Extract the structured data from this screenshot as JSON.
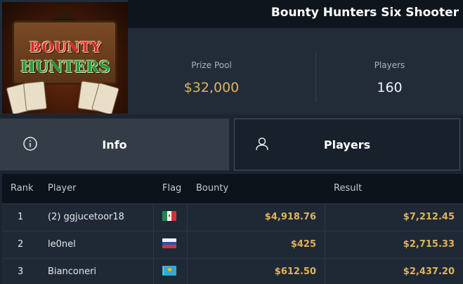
{
  "header": {
    "logo_text": [
      "BOUNTY",
      "HUNTERS"
    ],
    "title": "Bounty Hunters Six Shooter"
  },
  "stats": {
    "prize_pool": {
      "label": "Prize Pool",
      "value": "$32,000"
    },
    "players": {
      "label": "Players",
      "value": "160"
    }
  },
  "tabs": [
    {
      "label": "Info",
      "icon": "info-icon",
      "active": false
    },
    {
      "label": "Players",
      "icon": "user-icon",
      "active": true
    }
  ],
  "table": {
    "headers": [
      "Rank",
      "Player",
      "Flag",
      "Bounty",
      "Result"
    ],
    "rows": [
      {
        "rank": "1",
        "player": "(2) ggjucetoor18",
        "flag": "mexico-flag",
        "bounty": "$4,918.76",
        "result": "$7,212.45"
      },
      {
        "rank": "2",
        "player": "le0nel",
        "flag": "russia-flag",
        "bounty": "$425",
        "result": "$2,715.33"
      },
      {
        "rank": "3",
        "player": "Bianconeri",
        "flag": "kazakhstan-flag",
        "bounty": "$612.50",
        "result": "$2,437.20"
      }
    ]
  },
  "colors": {
    "accent_gold": "#e0b35a",
    "background": "#1b2430"
  }
}
